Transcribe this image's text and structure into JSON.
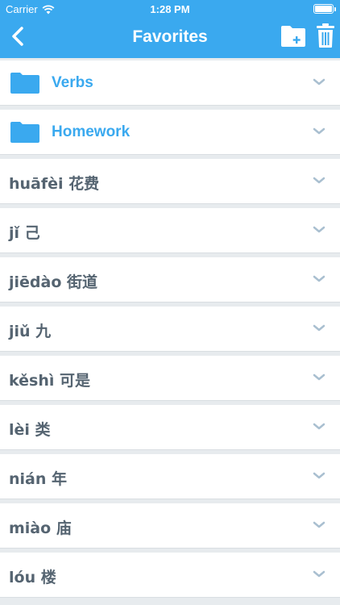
{
  "status_bar": {
    "carrier": "Carrier",
    "time": "1:28 PM",
    "battery_level": 1.0
  },
  "nav": {
    "title": "Favorites",
    "back_icon": "chevron-left-icon",
    "folder_add_icon": "folder-add-icon",
    "trash_icon": "trash-icon"
  },
  "colors": {
    "accent": "#3aa9ef",
    "word_text": "#556471",
    "background": "#e7ebee",
    "chevron": "#a9bfd0"
  },
  "folders": [
    {
      "label": "Verbs"
    },
    {
      "label": "Homework"
    }
  ],
  "words": [
    {
      "label": "huāfèi 花费"
    },
    {
      "label": "jǐ 己"
    },
    {
      "label": "jiēdào 街道"
    },
    {
      "label": "jiǔ 九"
    },
    {
      "label": "kěshì 可是"
    },
    {
      "label": "lèi 类"
    },
    {
      "label": "nián 年"
    },
    {
      "label": "miào 庙"
    },
    {
      "label": "lóu 楼"
    }
  ]
}
